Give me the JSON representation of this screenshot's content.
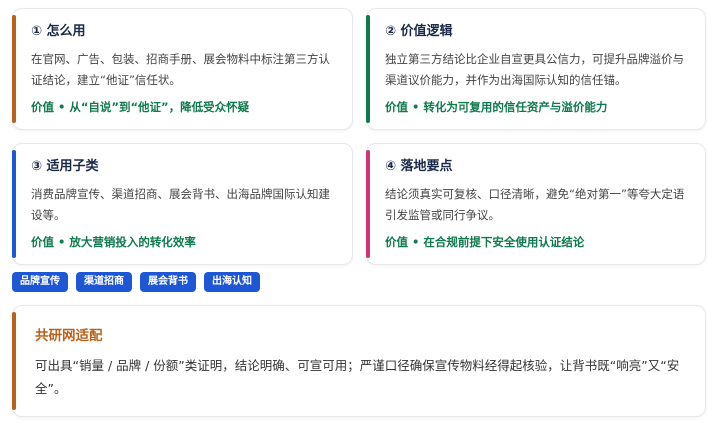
{
  "cards": [
    {
      "title": "① 怎么用",
      "body": "在官网、广告、包装、招商手册、展会物料中标注第三方认证结论，建立“他证”信任状。",
      "value": "价值 • 从“自说”到“他证”，降低受众怀疑",
      "accent": "#b8621b"
    },
    {
      "title": "② 价值逻辑",
      "body": "独立第三方结论比企业自宣更具公信力，可提升品牌溢价与渠道议价能力，并作为出海国际认知的信任锚。",
      "value": "价值 • 转化为可复用的信任资产与溢价能力",
      "accent": "#0f7a4e"
    },
    {
      "title": "③ 适用子类",
      "body": "消费品牌宣传、渠道招商、展会背书、出海品牌国际认知建设等。",
      "value": "价值 • 放大营销投入的转化效率",
      "accent": "#1d57d6"
    },
    {
      "title": "④ 落地要点",
      "body": "结论须真实可复核、口径清晰，避免“绝对第一”等夸大定语引发监管或同行争议。",
      "value": "价值 • 在合规前提下安全使用认证结论",
      "accent": "#cf3573"
    }
  ],
  "tags": [
    "品牌宣传",
    "渠道招商",
    "展会背书",
    "出海认知"
  ],
  "fit": {
    "title": "共研网适配",
    "body": "可出具“销量 / 品牌 / 份额”类证明，结论明确、可宣可用；严谨口径确保宣传物料经得起核验，让背书既“响亮”又“安全”。",
    "accent": "#b8621b"
  },
  "colors": {
    "tag_bg": "#1d57d6",
    "value_text": "#0f7a4e",
    "title_text": "#1b2a48"
  }
}
